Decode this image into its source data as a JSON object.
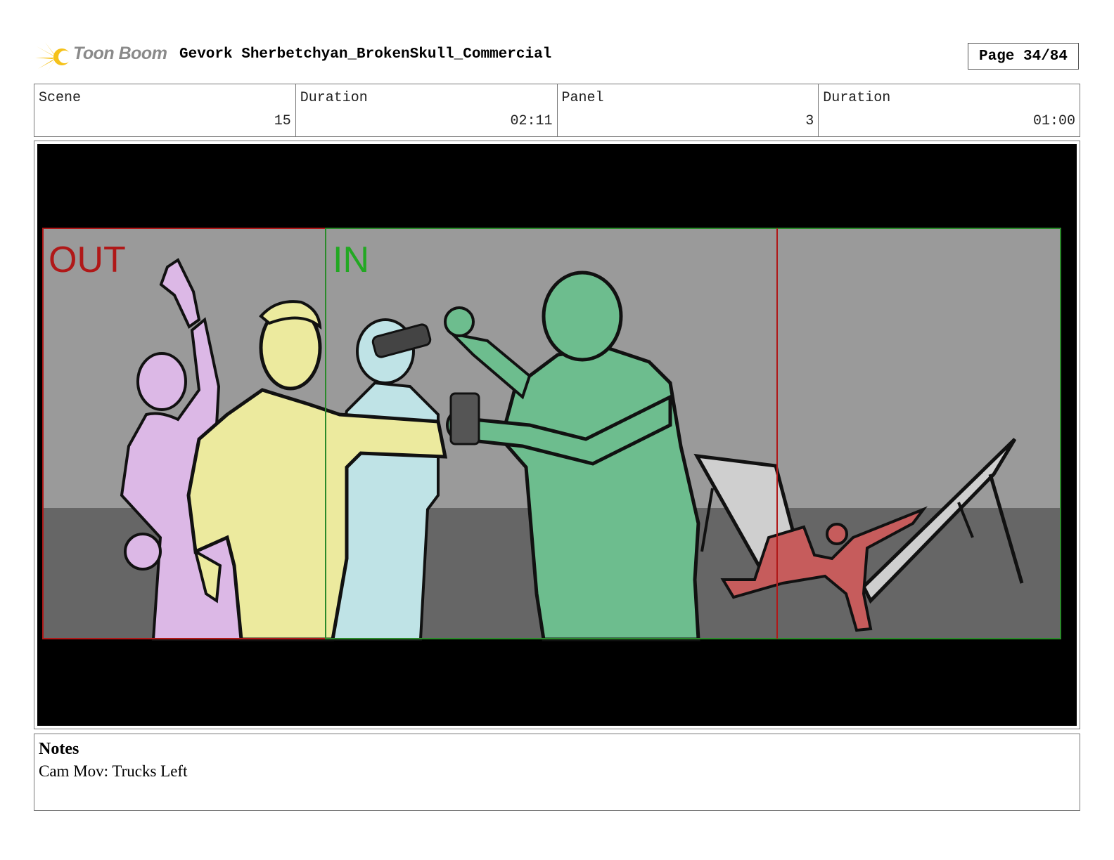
{
  "header": {
    "logo_text": "Toon Boom",
    "title": "Gevork Sherbetchyan_BrokenSkull_Commercial",
    "page": "Page 34/84"
  },
  "info": [
    {
      "label": "Scene",
      "value": "15"
    },
    {
      "label": "Duration",
      "value": "02:11"
    },
    {
      "label": "Panel",
      "value": "3"
    },
    {
      "label": "Duration",
      "value": "01:00"
    }
  ],
  "panel": {
    "out_label": "OUT",
    "in_label": "IN",
    "colors": {
      "out_frame": "#b01818",
      "in_frame": "#2a8a2a",
      "wall": "#9a9a9a",
      "floor": "#666666",
      "purple_figure": "#dcb8e6",
      "yellow_figure": "#ecea9e",
      "blue_figure": "#bfe3e6",
      "green_figure": "#6dbd8e",
      "red_figure": "#c65c5c"
    }
  },
  "notes": {
    "title": "Notes",
    "text": "Cam Mov: Trucks Left"
  }
}
